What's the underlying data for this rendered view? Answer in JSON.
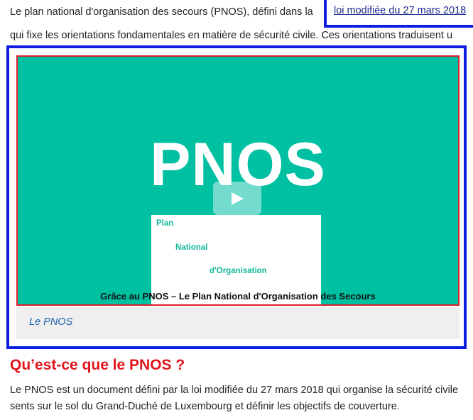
{
  "intro": {
    "line1": "Le plan national d'organisation des secours (PNOS), défini dans la",
    "link": "loi modifiée du 27 mars 2018",
    "line2": "qui fixe les orientations fondamentales en matière de sécurité civile. Ces orientations traduisent u"
  },
  "video": {
    "title": "PNOS",
    "card_words": [
      "Plan",
      "National",
      "d'Organisation"
    ],
    "overlay_caption": "Grâce au PNOS – Le Plan National d'Organisation des Secours",
    "play_icon": "play-icon",
    "background_color": "#00c0a2"
  },
  "figure": {
    "caption": "Le PNOS"
  },
  "section": {
    "heading": "Qu’est-ce que le PNOS ?",
    "line1": "Le PNOS est un document défini par la loi modifiée du 27 mars 2018 qui organise la sécurité civile",
    "line2": "sents sur le sol du Grand-Duché de Luxembourg et définir les objectifs de couverture."
  },
  "colors": {
    "heading": "#e0141b",
    "highlight_border": "#0d1ee0",
    "link": "#1b2a8f"
  }
}
